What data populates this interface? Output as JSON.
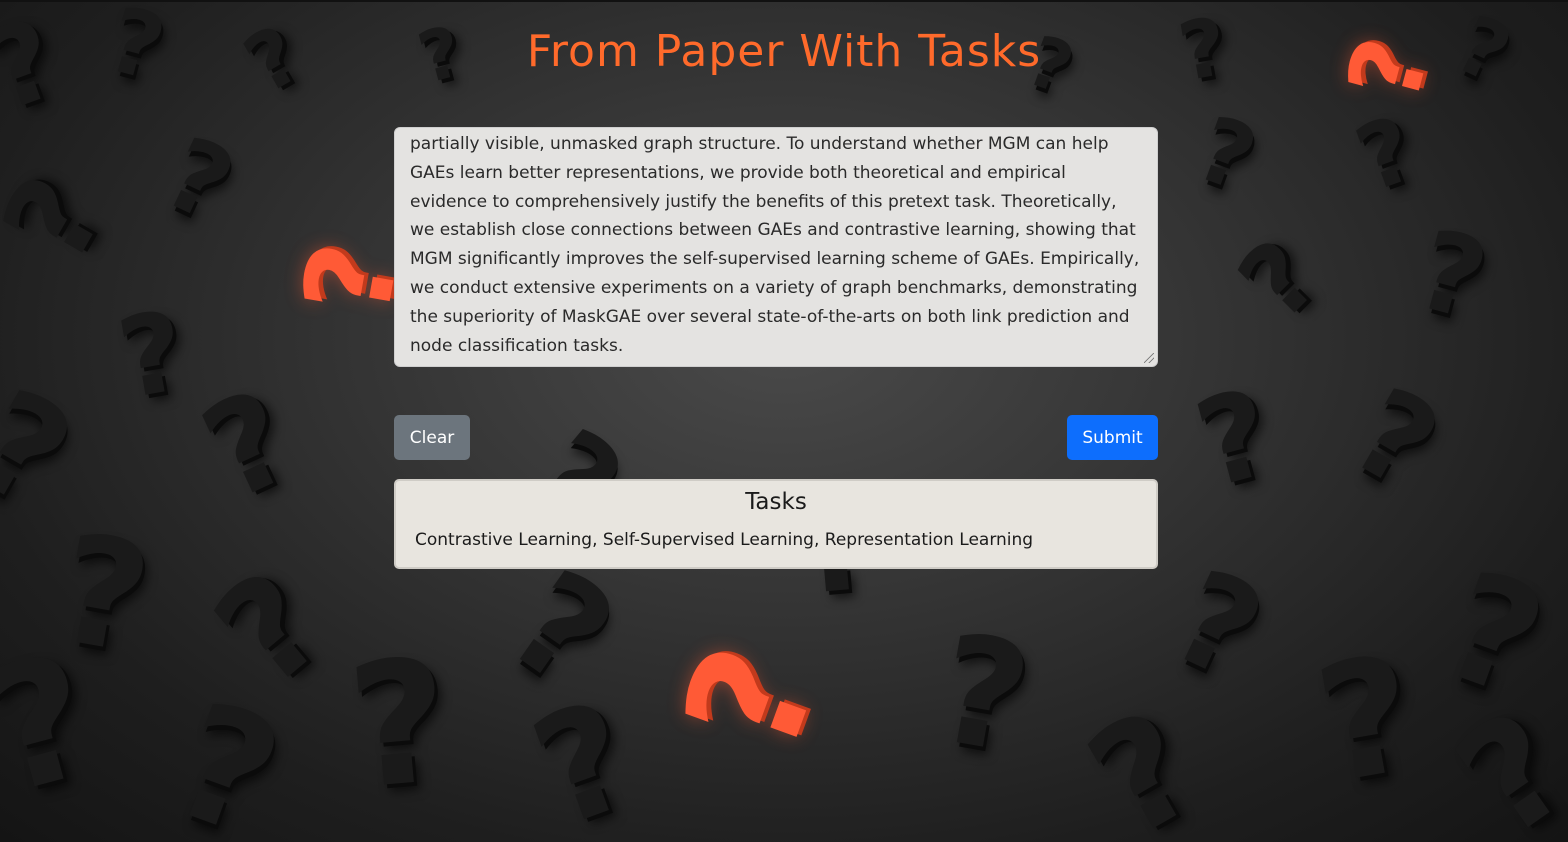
{
  "page": {
    "title": "From Paper With Tasks"
  },
  "input": {
    "abstract_text": "partially visible, unmasked graph structure. To understand whether MGM can help GAEs learn better representations, we provide both theoretical and empirical evidence to comprehensively justify the benefits of this pretext task. Theoretically, we establish close connections between GAEs and contrastive learning, showing that MGM significantly improves the self-supervised learning scheme of GAEs. Empirically, we conduct extensive experiments on a variety of graph benchmarks, demonstrating the superiority of MaskGAE over several state-of-the-arts on both link prediction and node classification tasks."
  },
  "buttons": {
    "clear_label": "Clear",
    "submit_label": "Submit"
  },
  "tasks": {
    "heading": "Tasks",
    "list": "Contrastive Learning, Self-Supervised Learning, Representation Learning"
  },
  "colors": {
    "title": "#ff6a2b",
    "submit": "#0d6efd",
    "clear": "#6c757d",
    "background": "#333333",
    "accent_question_marks": "#ff5a36"
  },
  "background_decoration": {
    "icon": "question-mark-icon"
  }
}
